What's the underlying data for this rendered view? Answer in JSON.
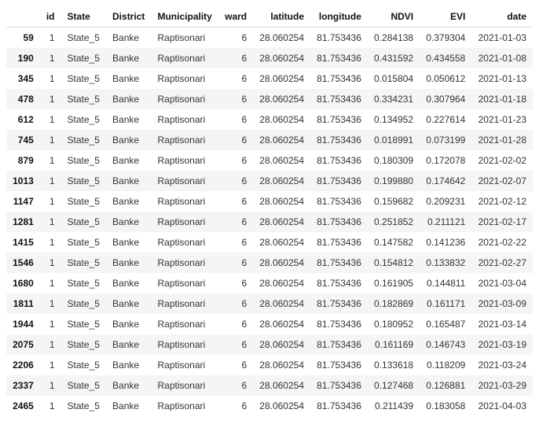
{
  "columns": [
    "",
    "id",
    "State",
    "District",
    "Municipality",
    "ward",
    "latitude",
    "longitude",
    "NDVI",
    "EVI",
    "date"
  ],
  "rows": [
    {
      "idx": "59",
      "id": "1",
      "State": "State_5",
      "District": "Banke",
      "Municipality": "Raptisonari",
      "ward": "6",
      "latitude": "28.060254",
      "longitude": "81.753436",
      "NDVI": "0.284138",
      "EVI": "0.379304",
      "date": "2021-01-03"
    },
    {
      "idx": "190",
      "id": "1",
      "State": "State_5",
      "District": "Banke",
      "Municipality": "Raptisonari",
      "ward": "6",
      "latitude": "28.060254",
      "longitude": "81.753436",
      "NDVI": "0.431592",
      "EVI": "0.434558",
      "date": "2021-01-08"
    },
    {
      "idx": "345",
      "id": "1",
      "State": "State_5",
      "District": "Banke",
      "Municipality": "Raptisonari",
      "ward": "6",
      "latitude": "28.060254",
      "longitude": "81.753436",
      "NDVI": "0.015804",
      "EVI": "0.050612",
      "date": "2021-01-13"
    },
    {
      "idx": "478",
      "id": "1",
      "State": "State_5",
      "District": "Banke",
      "Municipality": "Raptisonari",
      "ward": "6",
      "latitude": "28.060254",
      "longitude": "81.753436",
      "NDVI": "0.334231",
      "EVI": "0.307964",
      "date": "2021-01-18"
    },
    {
      "idx": "612",
      "id": "1",
      "State": "State_5",
      "District": "Banke",
      "Municipality": "Raptisonari",
      "ward": "6",
      "latitude": "28.060254",
      "longitude": "81.753436",
      "NDVI": "0.134952",
      "EVI": "0.227614",
      "date": "2021-01-23"
    },
    {
      "idx": "745",
      "id": "1",
      "State": "State_5",
      "District": "Banke",
      "Municipality": "Raptisonari",
      "ward": "6",
      "latitude": "28.060254",
      "longitude": "81.753436",
      "NDVI": "0.018991",
      "EVI": "0.073199",
      "date": "2021-01-28"
    },
    {
      "idx": "879",
      "id": "1",
      "State": "State_5",
      "District": "Banke",
      "Municipality": "Raptisonari",
      "ward": "6",
      "latitude": "28.060254",
      "longitude": "81.753436",
      "NDVI": "0.180309",
      "EVI": "0.172078",
      "date": "2021-02-02"
    },
    {
      "idx": "1013",
      "id": "1",
      "State": "State_5",
      "District": "Banke",
      "Municipality": "Raptisonari",
      "ward": "6",
      "latitude": "28.060254",
      "longitude": "81.753436",
      "NDVI": "0.199880",
      "EVI": "0.174642",
      "date": "2021-02-07"
    },
    {
      "idx": "1147",
      "id": "1",
      "State": "State_5",
      "District": "Banke",
      "Municipality": "Raptisonari",
      "ward": "6",
      "latitude": "28.060254",
      "longitude": "81.753436",
      "NDVI": "0.159682",
      "EVI": "0.209231",
      "date": "2021-02-12"
    },
    {
      "idx": "1281",
      "id": "1",
      "State": "State_5",
      "District": "Banke",
      "Municipality": "Raptisonari",
      "ward": "6",
      "latitude": "28.060254",
      "longitude": "81.753436",
      "NDVI": "0.251852",
      "EVI": "0.211121",
      "date": "2021-02-17"
    },
    {
      "idx": "1415",
      "id": "1",
      "State": "State_5",
      "District": "Banke",
      "Municipality": "Raptisonari",
      "ward": "6",
      "latitude": "28.060254",
      "longitude": "81.753436",
      "NDVI": "0.147582",
      "EVI": "0.141236",
      "date": "2021-02-22"
    },
    {
      "idx": "1546",
      "id": "1",
      "State": "State_5",
      "District": "Banke",
      "Municipality": "Raptisonari",
      "ward": "6",
      "latitude": "28.060254",
      "longitude": "81.753436",
      "NDVI": "0.154812",
      "EVI": "0.133832",
      "date": "2021-02-27"
    },
    {
      "idx": "1680",
      "id": "1",
      "State": "State_5",
      "District": "Banke",
      "Municipality": "Raptisonari",
      "ward": "6",
      "latitude": "28.060254",
      "longitude": "81.753436",
      "NDVI": "0.161905",
      "EVI": "0.144811",
      "date": "2021-03-04"
    },
    {
      "idx": "1811",
      "id": "1",
      "State": "State_5",
      "District": "Banke",
      "Municipality": "Raptisonari",
      "ward": "6",
      "latitude": "28.060254",
      "longitude": "81.753436",
      "NDVI": "0.182869",
      "EVI": "0.161171",
      "date": "2021-03-09"
    },
    {
      "idx": "1944",
      "id": "1",
      "State": "State_5",
      "District": "Banke",
      "Municipality": "Raptisonari",
      "ward": "6",
      "latitude": "28.060254",
      "longitude": "81.753436",
      "NDVI": "0.180952",
      "EVI": "0.165487",
      "date": "2021-03-14"
    },
    {
      "idx": "2075",
      "id": "1",
      "State": "State_5",
      "District": "Banke",
      "Municipality": "Raptisonari",
      "ward": "6",
      "latitude": "28.060254",
      "longitude": "81.753436",
      "NDVI": "0.161169",
      "EVI": "0.146743",
      "date": "2021-03-19"
    },
    {
      "idx": "2206",
      "id": "1",
      "State": "State_5",
      "District": "Banke",
      "Municipality": "Raptisonari",
      "ward": "6",
      "latitude": "28.060254",
      "longitude": "81.753436",
      "NDVI": "0.133618",
      "EVI": "0.118209",
      "date": "2021-03-24"
    },
    {
      "idx": "2337",
      "id": "1",
      "State": "State_5",
      "District": "Banke",
      "Municipality": "Raptisonari",
      "ward": "6",
      "latitude": "28.060254",
      "longitude": "81.753436",
      "NDVI": "0.127468",
      "EVI": "0.126881",
      "date": "2021-03-29"
    },
    {
      "idx": "2465",
      "id": "1",
      "State": "State_5",
      "District": "Banke",
      "Municipality": "Raptisonari",
      "ward": "6",
      "latitude": "28.060254",
      "longitude": "81.753436",
      "NDVI": "0.211439",
      "EVI": "0.183058",
      "date": "2021-04-03"
    }
  ]
}
